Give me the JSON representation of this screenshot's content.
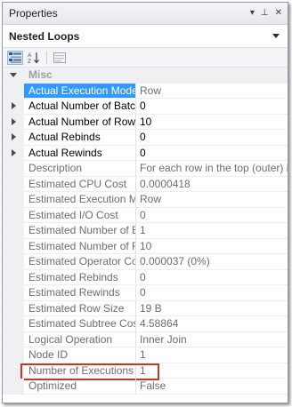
{
  "panel": {
    "title": "Properties",
    "pin_glyph": "▾",
    "dock_glyph": "⊥",
    "close_glyph": "✕"
  },
  "object": {
    "name": "Nested Loops"
  },
  "category": {
    "label": "Misc"
  },
  "properties": [
    {
      "name": "Actual Execution Mode",
      "value": "Row",
      "selected": true,
      "expandable": false,
      "editable": false
    },
    {
      "name": "Actual Number of Batches",
      "value": "0",
      "selected": false,
      "expandable": true,
      "editable": true
    },
    {
      "name": "Actual Number of Rows",
      "value": "10",
      "selected": false,
      "expandable": true,
      "editable": true
    },
    {
      "name": "Actual Rebinds",
      "value": "0",
      "selected": false,
      "expandable": true,
      "editable": true
    },
    {
      "name": "Actual Rewinds",
      "value": "0",
      "selected": false,
      "expandable": true,
      "editable": true
    },
    {
      "name": "Description",
      "value": "For each row in the top (outer) input",
      "selected": false,
      "expandable": false,
      "editable": false
    },
    {
      "name": "Estimated CPU Cost",
      "value": "0.0000418",
      "selected": false,
      "expandable": false,
      "editable": false
    },
    {
      "name": "Estimated Execution Mode",
      "value": "Row",
      "selected": false,
      "expandable": false,
      "editable": false
    },
    {
      "name": "Estimated I/O Cost",
      "value": "0",
      "selected": false,
      "expandable": false,
      "editable": false
    },
    {
      "name": "Estimated Number of Executions",
      "value": "1",
      "selected": false,
      "expandable": false,
      "editable": false
    },
    {
      "name": "Estimated Number of Rows",
      "value": "10",
      "selected": false,
      "expandable": false,
      "editable": false
    },
    {
      "name": "Estimated Operator Cost",
      "value": "0.000037 (0%)",
      "selected": false,
      "expandable": false,
      "editable": false
    },
    {
      "name": "Estimated Rebinds",
      "value": "0",
      "selected": false,
      "expandable": false,
      "editable": false
    },
    {
      "name": "Estimated Rewinds",
      "value": "0",
      "selected": false,
      "expandable": false,
      "editable": false
    },
    {
      "name": "Estimated Row Size",
      "value": "19 B",
      "selected": false,
      "expandable": false,
      "editable": false
    },
    {
      "name": "Estimated Subtree Cost",
      "value": "4.58864",
      "selected": false,
      "expandable": false,
      "editable": false
    },
    {
      "name": "Logical Operation",
      "value": "Inner Join",
      "selected": false,
      "expandable": false,
      "editable": false
    },
    {
      "name": "Node ID",
      "value": "1",
      "selected": false,
      "expandable": false,
      "editable": false
    },
    {
      "name": "Number of Executions",
      "value": "1",
      "selected": false,
      "expandable": false,
      "editable": false,
      "highlighted": true
    },
    {
      "name": "Optimized",
      "value": "False",
      "selected": false,
      "expandable": false,
      "editable": false
    }
  ]
}
